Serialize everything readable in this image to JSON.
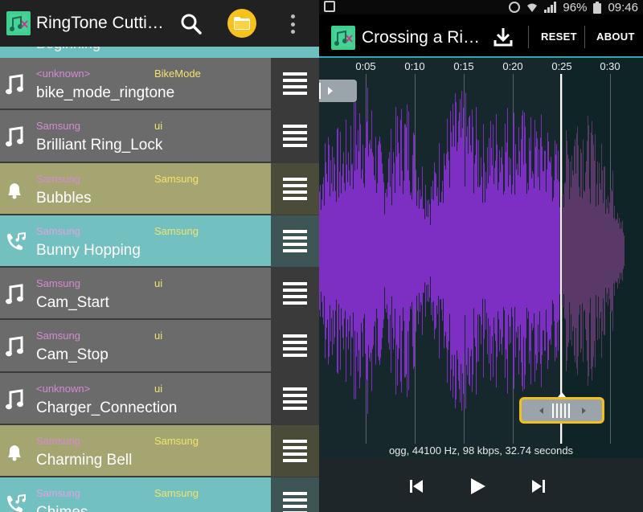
{
  "left_app": {
    "title": "RingTone Cutti…",
    "partial_row_text": "Beginning",
    "rows": [
      {
        "type": "music",
        "artist": "<unknown>",
        "album": "BikeMode",
        "title": "bike_mode_ringtone"
      },
      {
        "type": "music",
        "artist": "Samsung",
        "album": "ui",
        "title": "Brilliant Ring_Lock"
      },
      {
        "type": "notif",
        "artist": "Samsung",
        "album": "Samsung",
        "title": "Bubbles"
      },
      {
        "type": "ring",
        "artist": "Samsung",
        "album": "Samsung",
        "title": "Bunny Hopping"
      },
      {
        "type": "music",
        "artist": "Samsung",
        "album": "ui",
        "title": "Cam_Start"
      },
      {
        "type": "music",
        "artist": "Samsung",
        "album": "ui",
        "title": "Cam_Stop"
      },
      {
        "type": "music",
        "artist": "<unknown>",
        "album": "ui",
        "title": "Charger_Connection"
      },
      {
        "type": "notif",
        "artist": "Samsung",
        "album": "Samsung",
        "title": "Charming Bell"
      },
      {
        "type": "ring",
        "artist": "Samsung",
        "album": "Samsung",
        "title": "Chimes"
      }
    ],
    "colors": {
      "music_row": "#6b6b6b",
      "notif_row": "#a5a572",
      "ring_row": "#72c0c0",
      "artist_text": "#d68ad6",
      "album_text": "#f3e36b",
      "folder_button": "#f6c21c"
    }
  },
  "status_bar": {
    "battery": "96%",
    "time": "09:46"
  },
  "editor": {
    "song_title": "Crossing a Ri…",
    "reset_label": "RESET",
    "about_label": "ABOUT",
    "timeline_ticks": [
      "0:05",
      "0:10",
      "0:15",
      "0:20",
      "0:25",
      "0:30"
    ],
    "file_info": "ogg, 44100 Hz, 98 kbps, 32.74 seconds",
    "playhead_time_seconds": 25.2,
    "selection_start_seconds": 0,
    "selection_end_seconds": 25.2,
    "colors": {
      "waveform_selected": "#7d2fc4",
      "waveform_unselected": "#5a3868",
      "accent": "#2fa9b3",
      "end_marker_border": "#f3c01a"
    }
  }
}
